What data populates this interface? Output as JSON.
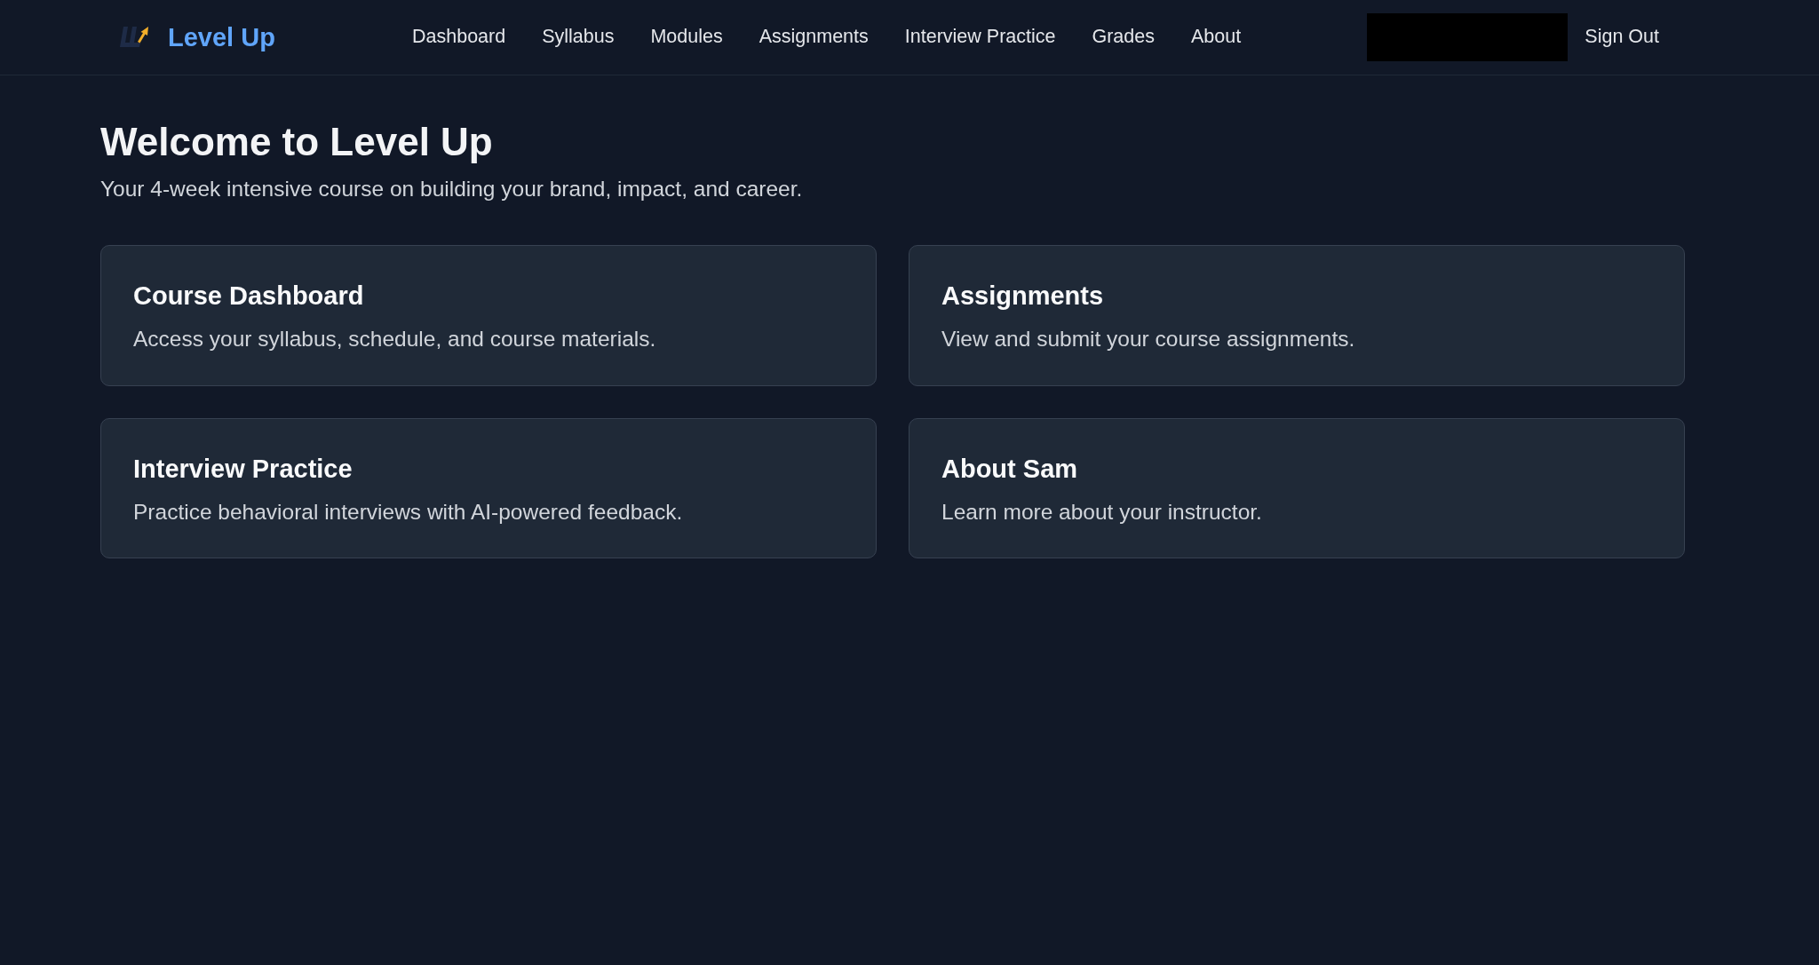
{
  "header": {
    "brand": "Level Up",
    "nav": [
      "Dashboard",
      "Syllabus",
      "Modules",
      "Assignments",
      "Interview Practice",
      "Grades",
      "About"
    ],
    "sign_out": "Sign Out"
  },
  "hero": {
    "title": "Welcome to Level Up",
    "subtitle": "Your 4-week intensive course on building your brand, impact, and career."
  },
  "cards": [
    {
      "title": "Course Dashboard",
      "description": "Access your syllabus, schedule, and course materials."
    },
    {
      "title": "Assignments",
      "description": "View and submit your course assignments."
    },
    {
      "title": "Interview Practice",
      "description": "Practice behavioral interviews with AI-powered feedback."
    },
    {
      "title": "About Sam",
      "description": "Learn more about your instructor."
    }
  ]
}
